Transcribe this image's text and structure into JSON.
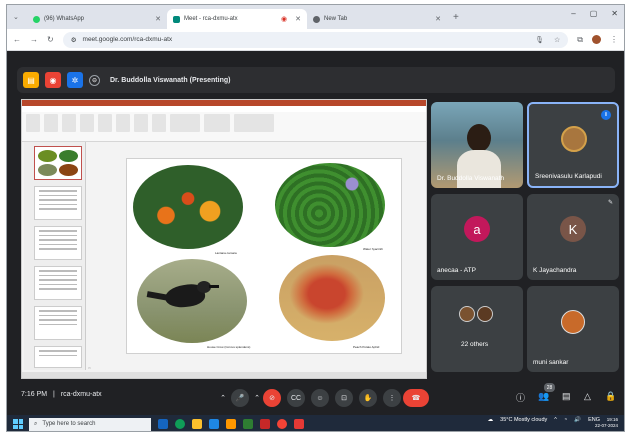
{
  "browser": {
    "tabs": [
      {
        "title": "(96) WhatsApp",
        "icon": "whatsapp-icon",
        "color": "#25d366"
      },
      {
        "title": "Meet - rca-dxmu-atx",
        "icon": "meet-icon",
        "color": "#00897b"
      },
      {
        "title": "New Tab",
        "icon": "chrome-icon",
        "color": "#5f6368"
      }
    ],
    "url": "meet.google.com/rca-dxmu-atx",
    "window_controls": [
      "–",
      "▢",
      "✕"
    ]
  },
  "meet": {
    "presenter_title": "Dr. Buddolla Viswanath (Presenting)",
    "meeting_time": "7:16 PM",
    "meeting_code": "rca-dxmu-atx",
    "separator": "|",
    "participant_count": "28",
    "tiles": [
      {
        "name": "Dr. Buddolla Viswanath"
      },
      {
        "name": "Sreenivasulu Karlapudi"
      },
      {
        "name": "anecaa - ATP",
        "initial": "a",
        "color": "#c2185b"
      },
      {
        "name": "K Jayachandra",
        "initial": "K",
        "color": "#795548"
      },
      {
        "name": "22 others"
      },
      {
        "name": "muni sankar"
      }
    ]
  },
  "slide": {
    "captions": [
      "Lantana camara",
      "Water hyacinth",
      "House Crow (Corvus splendens)",
      "Peach Potato Aphid"
    ]
  },
  "taskbar": {
    "search_placeholder": "Type here to search",
    "weather": "35°C  Mostly cloudy",
    "lang": "ENG",
    "time": "19:16",
    "date": "22-07-2024"
  }
}
